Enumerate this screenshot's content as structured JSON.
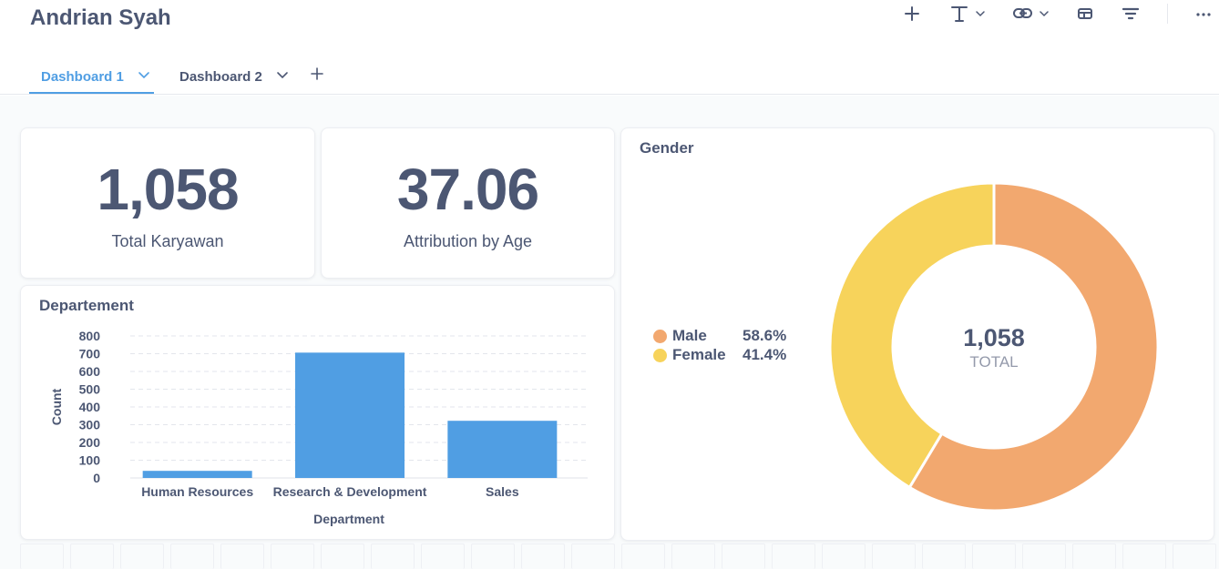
{
  "header": {
    "title": "Andrian Syah",
    "toolbar": [
      {
        "icon": "plus-icon"
      },
      {
        "icon": "text-icon"
      },
      {
        "icon": "link-icon"
      },
      {
        "icon": "section-icon"
      },
      {
        "icon": "filter-icon"
      },
      {
        "icon": "more-icon"
      }
    ]
  },
  "tabs": [
    {
      "label": "Dashboard 1",
      "active": true
    },
    {
      "label": "Dashboard 2",
      "active": false
    }
  ],
  "cards": {
    "total": {
      "value": "1,058",
      "label": "Total Karyawan"
    },
    "age": {
      "value": "37.06",
      "label": "Attribution by Age"
    }
  },
  "departement": {
    "title": "Departement",
    "chart_data": {
      "type": "bar",
      "categories": [
        "Human Resources",
        "Research & Development",
        "Sales"
      ],
      "values": [
        40,
        706,
        322
      ],
      "xlabel": "Department",
      "ylabel": "Count",
      "yticks": [
        0,
        100,
        200,
        300,
        400,
        500,
        600,
        700,
        800
      ],
      "ylim": [
        0,
        800
      ],
      "grid": true,
      "color": "#509ee3"
    }
  },
  "gender": {
    "title": "Gender",
    "chart_data": {
      "type": "pie",
      "donut": true,
      "labels": [
        "Male",
        "Female"
      ],
      "values": [
        58.6,
        41.4
      ],
      "value_labels": [
        "58.6%",
        "41.4%"
      ],
      "colors": [
        "#f2a86f",
        "#f7d35b"
      ],
      "center_value": "1,058",
      "center_label": "TOTAL",
      "legend": "left"
    }
  }
}
